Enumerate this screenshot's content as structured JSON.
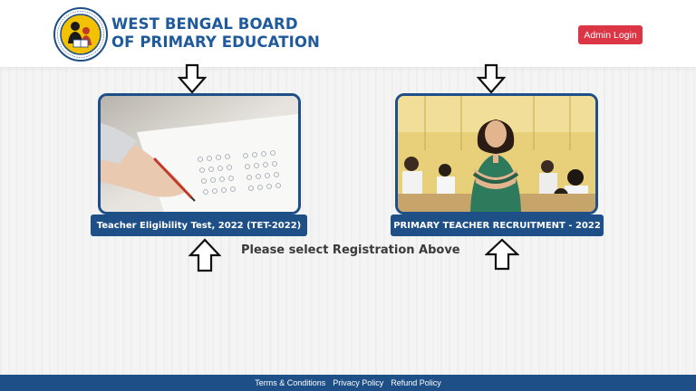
{
  "header": {
    "brand_line1": "WEST BENGAL BOARD",
    "brand_line2": "OF PRIMARY EDUCATION",
    "admin_login": "Admin Login"
  },
  "cards": [
    {
      "label": "Teacher Eligibility Test, 2022 (TET-2022)"
    },
    {
      "label": "PRIMARY TEACHER RECRUITMENT - 2022"
    }
  ],
  "instruction": "Please select Registration Above",
  "footer": {
    "links": [
      "Terms & Conditions",
      "Privacy Policy",
      "Refund Policy"
    ]
  },
  "colors": {
    "brand_blue": "#1e5a9c",
    "card_blue": "#1e4f86",
    "admin_red": "#dc3545"
  },
  "icons": {
    "logo": "wbbpe-logo",
    "down_arrow": "arrow-down-outline-icon",
    "up_arrow": "arrow-up-outline-icon"
  }
}
